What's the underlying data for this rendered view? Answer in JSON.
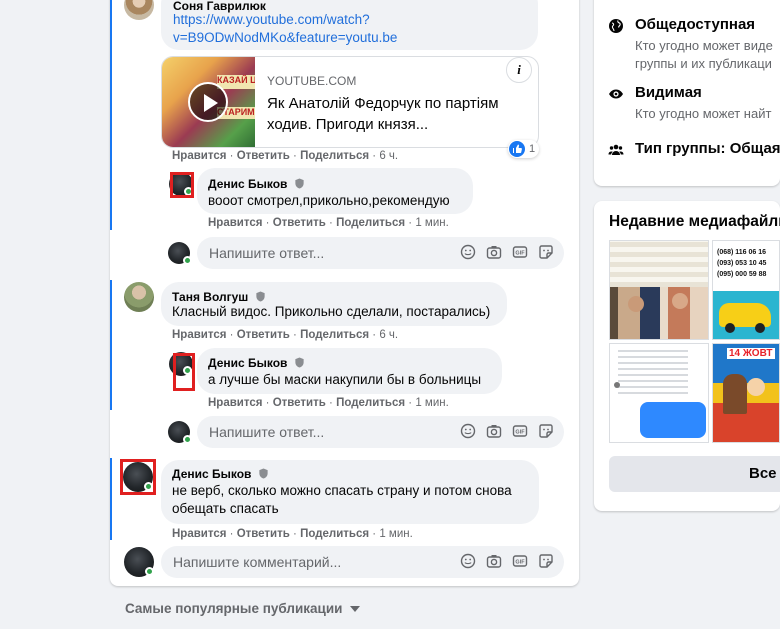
{
  "comments": {
    "c1": {
      "author": "Соня Гаврилюк",
      "link_line1": "https://www.youtube.com/watch?",
      "link_line2": "v=B9ODwNodMKo&feature=youtu.be",
      "preview": {
        "domain": "YOUTUBE.COM",
        "title": "Як Анатолій Федорчук по партіям ходив. Пригоди князя...",
        "thumb_text_1": "КАЗАЙ Ц",
        "thumb_text_2": "СТАРИМ К",
        "info": "i"
      },
      "like_count": "1",
      "actions": {
        "like": "Нравится",
        "reply": "Ответить",
        "share": "Поделиться",
        "time": "6 ч."
      },
      "replies": [
        {
          "author": "Денис Быков",
          "text": "вооот смотрел,прикольно,рекомендую",
          "actions": {
            "like": "Нравится",
            "reply": "Ответить",
            "share": "Поделиться",
            "time": "1 мин."
          }
        }
      ],
      "reply_placeholder": "Напишите ответ..."
    },
    "c2": {
      "author": "Таня Волгуш",
      "text": "Класный видос. Прикольно сделали, постарались)",
      "actions": {
        "like": "Нравится",
        "reply": "Ответить",
        "share": "Поделиться",
        "time": "6 ч."
      },
      "replies": [
        {
          "author": "Денис Быков",
          "text": "а лучше бы маски накупили бы в больницы",
          "actions": {
            "like": "Нравится",
            "reply": "Ответить",
            "share": "Поделиться",
            "time": "1 мин."
          }
        }
      ],
      "reply_placeholder": "Напишите ответ..."
    },
    "c3": {
      "author": "Денис Быков",
      "text_line1": "не верб, сколько можно спасать страну и потом снова",
      "text_line2": "обещать спасать",
      "actions": {
        "like": "Нравится",
        "reply": "Ответить",
        "share": "Поделиться",
        "time": "1 мин."
      }
    },
    "comment_placeholder": "Напишите комментарий..."
  },
  "popular": "Самые популярные публикации",
  "sidebar": {
    "about": [
      {
        "icon": "globe-icon",
        "title": "Общедоступная",
        "desc_1": "Кто угодно может виде",
        "desc_2": "группы и их публикаци"
      },
      {
        "icon": "eye-icon",
        "title": "Видимая",
        "desc_1": "Кто угодно может найт"
      },
      {
        "icon": "people-icon",
        "title": "Тип группы: Общая"
      }
    ],
    "media": {
      "title": "Недавние медиафайлы",
      "phones": [
        "(068) 116 06 16",
        "(093) 053 10 45",
        "(095) 000 59 88"
      ],
      "banner": "14 ЖОВТ",
      "see_all": "Все"
    }
  },
  "colors": {
    "accent": "#1877f2",
    "highlight": "#e02020",
    "bubble": "#f0f2f5",
    "muted": "#65676b"
  }
}
